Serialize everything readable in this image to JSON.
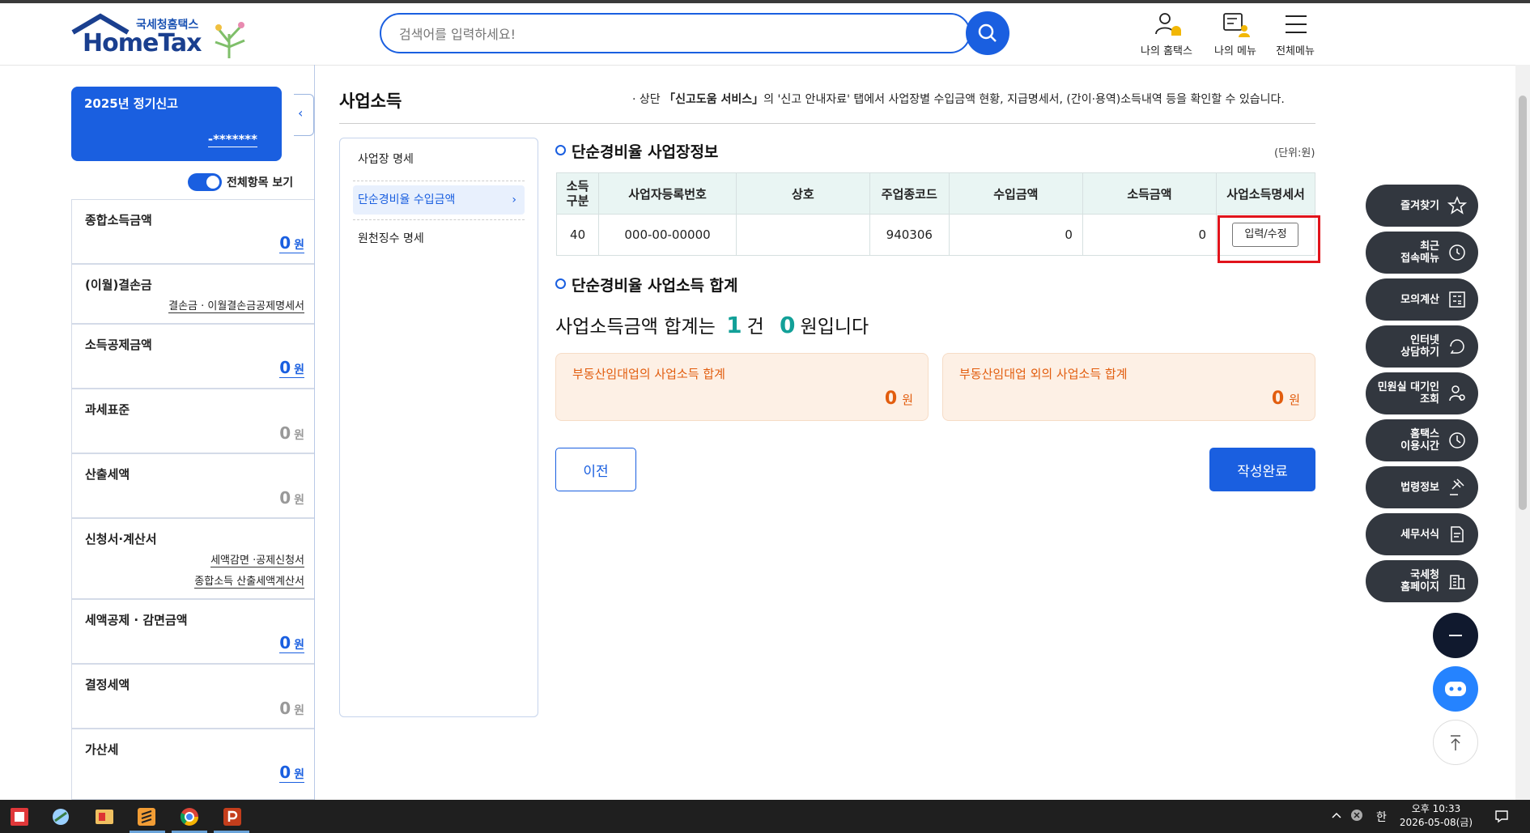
{
  "header": {
    "logo_korean": "국세청홈택스",
    "logo_brand": "HomeTax",
    "search_placeholder": "검색어를 입력하세요!",
    "menu": [
      {
        "label": "나의 홈택스",
        "icon": "person-bell-icon"
      },
      {
        "label": "나의 메뉴",
        "icon": "my-menu-icon"
      },
      {
        "label": "전체메뉴",
        "icon": "hamburger-icon"
      }
    ]
  },
  "sidebar": {
    "card_title": "2025년 정기신고",
    "card_name": "-*******",
    "toggle_label": "전체항목 보기",
    "toggle_on": true,
    "items": [
      {
        "label": "종합소득금액",
        "value": "0",
        "unit": "원"
      },
      {
        "label": "(이월)결손금",
        "links": [
          "결손금 · 이월결손금공제명세서"
        ]
      },
      {
        "label": "소득공제금액",
        "value": "0",
        "unit": "원"
      },
      {
        "label": "과세표준",
        "value": "0",
        "unit": "원"
      },
      {
        "label": "산출세액",
        "value": "0",
        "unit": "원"
      },
      {
        "label": "신청서·계산서",
        "links": [
          "세액감면 ·공제신청서",
          "종합소득 산출세액계산서"
        ]
      },
      {
        "label": "세액공제 · 감면금액",
        "value": "0",
        "unit": "원"
      },
      {
        "label": "결정세액",
        "value": "0",
        "unit": "원"
      },
      {
        "label": "가산세",
        "value": "0",
        "unit": "원"
      }
    ]
  },
  "main": {
    "title": "사업소득",
    "notice_prefix": "· 상단 ",
    "notice_bold": "「신고도움 서비스」",
    "notice_rest": "의 '신고 안내자료' 탭에서 사업장별 수입금액 현황, 지급명세서, (간이·용역)소득내역 등을 확인할 수 있습니다.",
    "subnav": [
      {
        "label": "사업장 명세",
        "active": false
      },
      {
        "label": "단순경비율 수입금액",
        "active": true
      },
      {
        "label": "원천징수 명세",
        "active": false
      }
    ],
    "section1_title": "단순경비율 사업장정보",
    "unit_label": "(단위:원)",
    "table": {
      "headers": [
        "소득\n구분",
        "사업자등록번호",
        "상호",
        "주업종코드",
        "수입금액",
        "소득금액",
        "사업소득명세서"
      ],
      "rows": [
        {
          "income_type": "40",
          "biz_no": "000-00-00000",
          "name": "",
          "industry_code": "940306",
          "revenue": "0",
          "income": "0",
          "action": "입력/수정"
        }
      ]
    },
    "section2_title": "단순경비율 사업소득 합계",
    "summary": {
      "prefix": "사업소득금액 합계는",
      "count": "1",
      "count_unit": "건",
      "amount": "0",
      "suffix": "원입니다"
    },
    "cards": [
      {
        "label": "부동산임대업의 사업소득 합계",
        "value": "0",
        "unit": "원"
      },
      {
        "label": "부동산임대업 외의 사업소득 합계",
        "value": "0",
        "unit": "원"
      }
    ],
    "btn_prev": "이전",
    "btn_done": "작성완료"
  },
  "quick_menu": [
    {
      "label": "즐겨찾기",
      "icon": "star-icon"
    },
    {
      "label": "최근\n접속메뉴",
      "icon": "clock-icon"
    },
    {
      "label": "모의계산",
      "icon": "calculator-icon"
    },
    {
      "label": "인터넷\n상담하기",
      "icon": "chat-icon"
    },
    {
      "label": "민원실 대기인\n조회",
      "icon": "person-search-icon"
    },
    {
      "label": "홈택스\n이용시간",
      "icon": "time-icon"
    },
    {
      "label": "법령정보",
      "icon": "gavel-icon"
    },
    {
      "label": "세무서식",
      "icon": "form-icon"
    },
    {
      "label": "국세청\n홈페이지",
      "icon": "building-icon"
    }
  ],
  "taskbar": {
    "ime": "한",
    "time": "오후 10:33",
    "date": "2026-05-08(금)"
  },
  "colors": {
    "primary": "#1a5fe0",
    "accent_orange": "#e25d0e",
    "teal": "#12a098",
    "highlight_red": "#e1141c"
  }
}
